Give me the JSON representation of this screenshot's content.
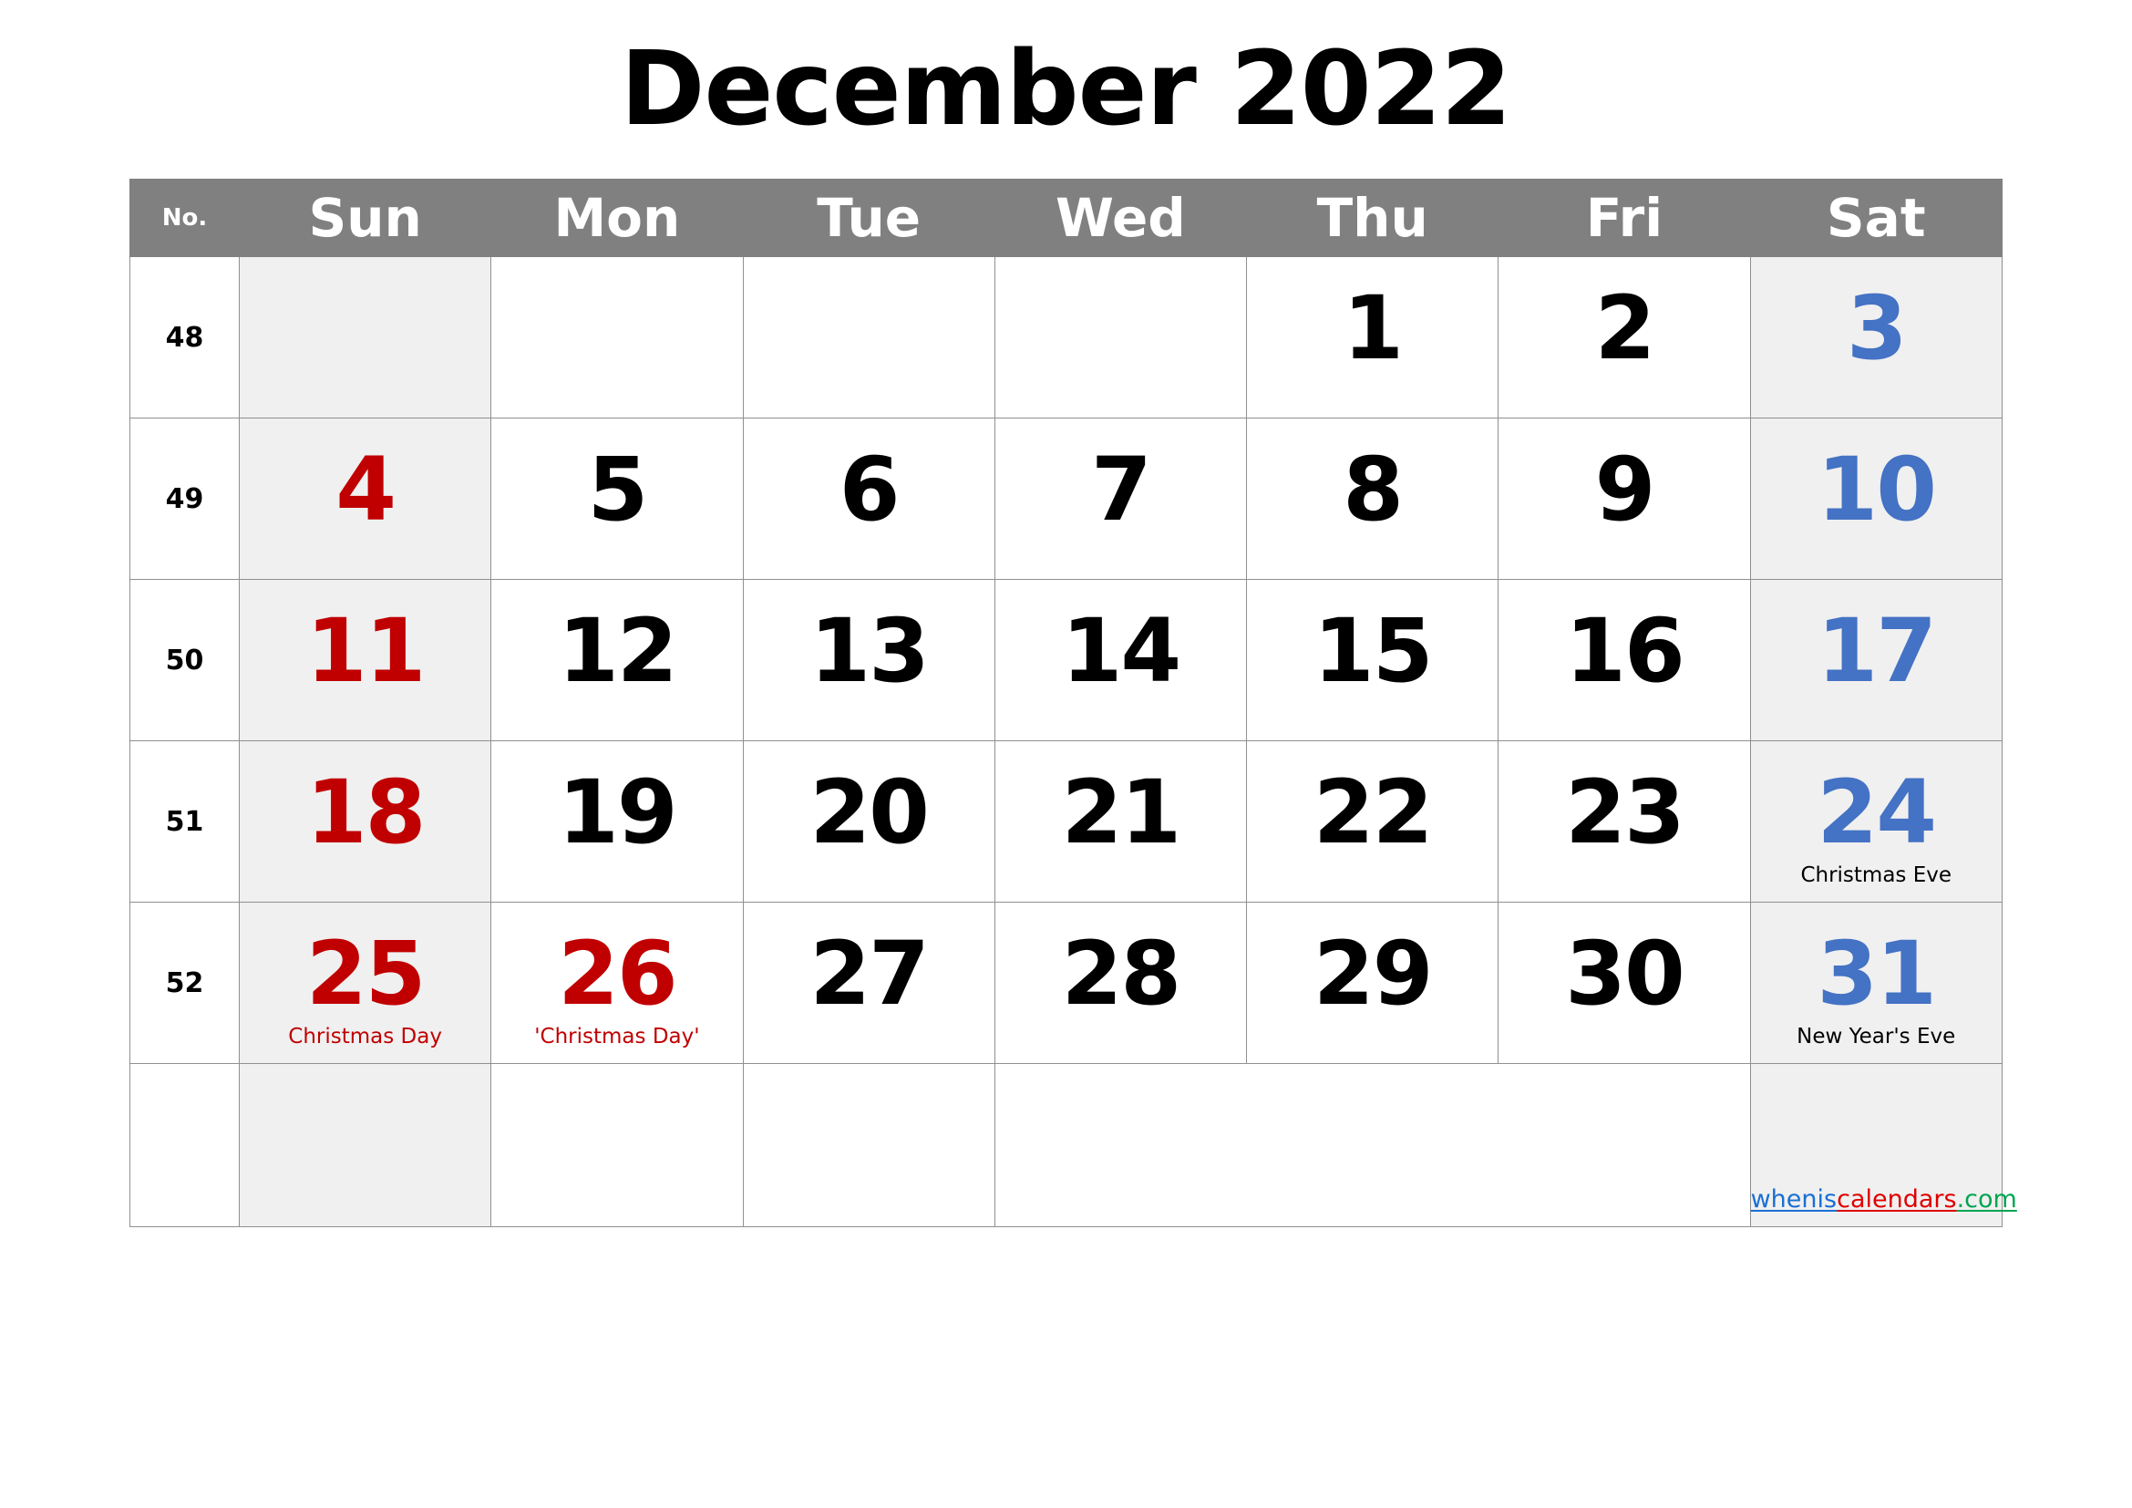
{
  "title": "December 2022",
  "header": {
    "week_col_label": "No.",
    "days": [
      "Sun",
      "Mon",
      "Tue",
      "Wed",
      "Thu",
      "Fri",
      "Sat"
    ]
  },
  "colors": {
    "header_bg": "#808080",
    "header_text": "#ffffff",
    "weekend_bg": "#f0f0f0",
    "sunday_text": "#c00000",
    "saturday_text": "#4472c4",
    "weekday_text": "#000000",
    "grid_line": "#909090",
    "link_blue": "#1a6fd4",
    "link_red": "#e00000",
    "link_green": "#00a550"
  },
  "weeks": [
    {
      "no": "48",
      "days": [
        {
          "num": "",
          "tone": "sun",
          "holiday": ""
        },
        {
          "num": "",
          "tone": "weekday",
          "holiday": ""
        },
        {
          "num": "",
          "tone": "weekday",
          "holiday": ""
        },
        {
          "num": "",
          "tone": "weekday",
          "holiday": ""
        },
        {
          "num": "1",
          "tone": "weekday",
          "holiday": ""
        },
        {
          "num": "2",
          "tone": "weekday",
          "holiday": ""
        },
        {
          "num": "3",
          "tone": "sat",
          "holiday": ""
        }
      ]
    },
    {
      "no": "49",
      "days": [
        {
          "num": "4",
          "tone": "sun",
          "holiday": ""
        },
        {
          "num": "5",
          "tone": "weekday",
          "holiday": ""
        },
        {
          "num": "6",
          "tone": "weekday",
          "holiday": ""
        },
        {
          "num": "7",
          "tone": "weekday",
          "holiday": ""
        },
        {
          "num": "8",
          "tone": "weekday",
          "holiday": ""
        },
        {
          "num": "9",
          "tone": "weekday",
          "holiday": ""
        },
        {
          "num": "10",
          "tone": "sat",
          "holiday": ""
        }
      ]
    },
    {
      "no": "50",
      "days": [
        {
          "num": "11",
          "tone": "sun",
          "holiday": ""
        },
        {
          "num": "12",
          "tone": "weekday",
          "holiday": ""
        },
        {
          "num": "13",
          "tone": "weekday",
          "holiday": ""
        },
        {
          "num": "14",
          "tone": "weekday",
          "holiday": ""
        },
        {
          "num": "15",
          "tone": "weekday",
          "holiday": ""
        },
        {
          "num": "16",
          "tone": "weekday",
          "holiday": ""
        },
        {
          "num": "17",
          "tone": "sat",
          "holiday": ""
        }
      ]
    },
    {
      "no": "51",
      "days": [
        {
          "num": "18",
          "tone": "sun",
          "holiday": ""
        },
        {
          "num": "19",
          "tone": "weekday",
          "holiday": ""
        },
        {
          "num": "20",
          "tone": "weekday",
          "holiday": ""
        },
        {
          "num": "21",
          "tone": "weekday",
          "holiday": ""
        },
        {
          "num": "22",
          "tone": "weekday",
          "holiday": ""
        },
        {
          "num": "23",
          "tone": "weekday",
          "holiday": ""
        },
        {
          "num": "24",
          "tone": "sat",
          "holiday": "Christmas Eve"
        }
      ]
    },
    {
      "no": "52",
      "days": [
        {
          "num": "25",
          "tone": "sun",
          "holiday": "Christmas Day"
        },
        {
          "num": "26",
          "tone": "red-weekday",
          "holiday": "'Christmas Day'"
        },
        {
          "num": "27",
          "tone": "weekday",
          "holiday": ""
        },
        {
          "num": "28",
          "tone": "weekday",
          "holiday": ""
        },
        {
          "num": "29",
          "tone": "weekday",
          "holiday": ""
        },
        {
          "num": "30",
          "tone": "weekday",
          "holiday": ""
        },
        {
          "num": "31",
          "tone": "sat",
          "holiday": "New Year's Eve"
        }
      ]
    }
  ],
  "footer_link": {
    "part1": "whenis",
    "part2": "calendars",
    "part3": ".com"
  }
}
